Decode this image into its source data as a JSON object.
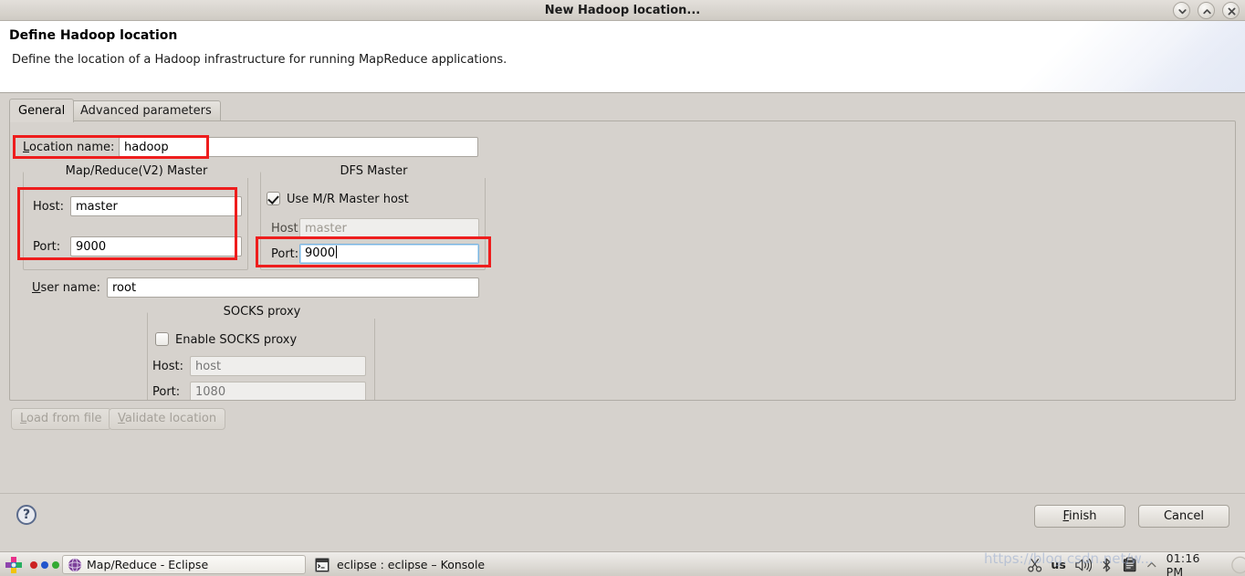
{
  "window": {
    "title": "New Hadoop location...",
    "controls": [
      {
        "name": "minimize",
        "glyph": "chevron-down"
      },
      {
        "name": "maximize",
        "glyph": "chevron-up"
      },
      {
        "name": "close",
        "glyph": "x"
      }
    ]
  },
  "header": {
    "title": "Define Hadoop location",
    "description": "Define the location of a Hadoop infrastructure for running MapReduce applications."
  },
  "tabs": [
    {
      "label": "General",
      "selected": true
    },
    {
      "label": "Advanced parameters",
      "selected": false
    }
  ],
  "form": {
    "location_name": {
      "label_prefix": "",
      "label_mnemonic": "L",
      "label_suffix": "ocation name:",
      "value": "hadoop",
      "highlighted": true
    },
    "mapreduce_master": {
      "group_title": "Map/Reduce(V2) Master",
      "host_label": "Host:",
      "host_value": "master",
      "port_label": "Port:",
      "port_value": "9000",
      "highlighted": true
    },
    "dfs_master": {
      "group_title": "DFS Master",
      "use_mr_master_host_label": "Use M/R Master host",
      "use_mr_master_host_checked": true,
      "host_label": "Host:",
      "host_value": "master",
      "host_disabled": true,
      "port_label": "Port:",
      "port_value": "9000",
      "port_focused": true,
      "highlighted": true
    },
    "user_name": {
      "label_mnemonic": "U",
      "label_suffix": "ser name:",
      "value": "root"
    },
    "socks_proxy": {
      "group_title": "SOCKS proxy",
      "enable_label": "Enable SOCKS proxy",
      "enable_checked": false,
      "host_label": "Host:",
      "host_placeholder": "host",
      "host_disabled": true,
      "port_label": "Port:",
      "port_placeholder": "1080",
      "port_disabled": true
    }
  },
  "actions": {
    "load_from_file": {
      "mnemonic": "L",
      "suffix": "oad from file",
      "disabled": true
    },
    "validate_location": {
      "mnemonic": "V",
      "suffix": "alidate location",
      "disabled": true
    }
  },
  "footer": {
    "help_glyph": "?",
    "finish": {
      "mnemonic": "F",
      "suffix": "inish"
    },
    "cancel": {
      "label": "Cancel"
    }
  },
  "taskbar": {
    "launcher_icon": "kde-launcher-icon",
    "pager_dots": [
      "#cc2222",
      "#2255cc",
      "#33aa33"
    ],
    "windows": [
      {
        "label": "Map/Reduce - Eclipse",
        "icon": "eclipse-globe-icon",
        "active": true
      },
      {
        "label": "eclipse : eclipse – Konsole",
        "icon": "konsole-terminal-icon",
        "active": false
      }
    ],
    "tray": {
      "items": [
        {
          "name": "scissors-icon"
        },
        {
          "name": "keyboard-layout",
          "text": "us"
        },
        {
          "name": "volume-icon"
        },
        {
          "name": "bluetooth-icon"
        },
        {
          "name": "klipper-icon"
        },
        {
          "name": "show-hidden-icon"
        }
      ],
      "clock": "01:16 PM"
    },
    "watermark": "https://blog.csdn.net/w..."
  },
  "colors": {
    "annotation_red": "#ee1d1d",
    "focus_blue": "#7ab4e0",
    "dialog_bg": "#d6d2cd"
  }
}
